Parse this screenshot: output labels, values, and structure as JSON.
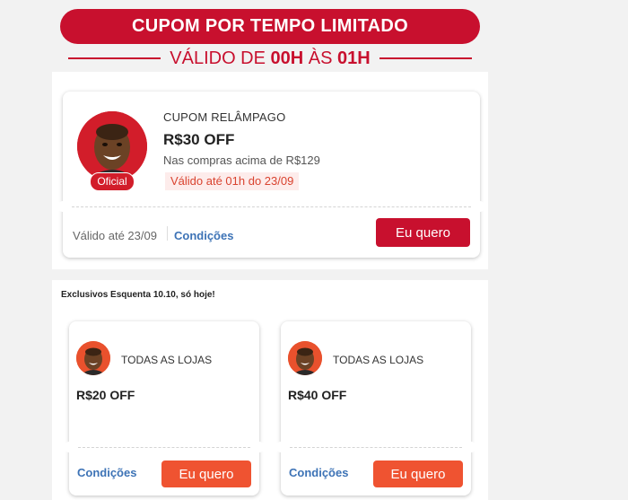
{
  "banner": {
    "title": "CUPOM POR TEMPO LIMITADO"
  },
  "validity": {
    "prefix": "VÁLIDO DE ",
    "start": "00H",
    "middle": " ÀS ",
    "end": "01H"
  },
  "flash_coupon": {
    "label": "CUPOM RELÂMPAGO",
    "amount": "R$30 OFF",
    "condition": "Nas compras acima de R$129",
    "valid_badge": "Válido até 01h do 23/09",
    "official_badge": "Oficial",
    "footer_valid": "Válido até 23/09",
    "conditions_link": "Condições",
    "cta": "Eu quero"
  },
  "section": {
    "title": "Exclusivos Esquenta 10.10, só hoje!",
    "coupons": [
      {
        "store": "TODAS AS LOJAS",
        "amount": "R$20 OFF",
        "conditions_link": "Condições",
        "cta": "Eu quero"
      },
      {
        "store": "TODAS AS LOJAS",
        "amount": "R$40 OFF",
        "conditions_link": "Condições",
        "cta": "Eu quero"
      }
    ]
  },
  "colors": {
    "brand_red": "#c8102e",
    "cta_orange": "#ef5331",
    "link_blue": "#3d73b6",
    "badge_text": "#d9432f"
  },
  "icons": {
    "store_avatar": "person-avatar-icon"
  }
}
